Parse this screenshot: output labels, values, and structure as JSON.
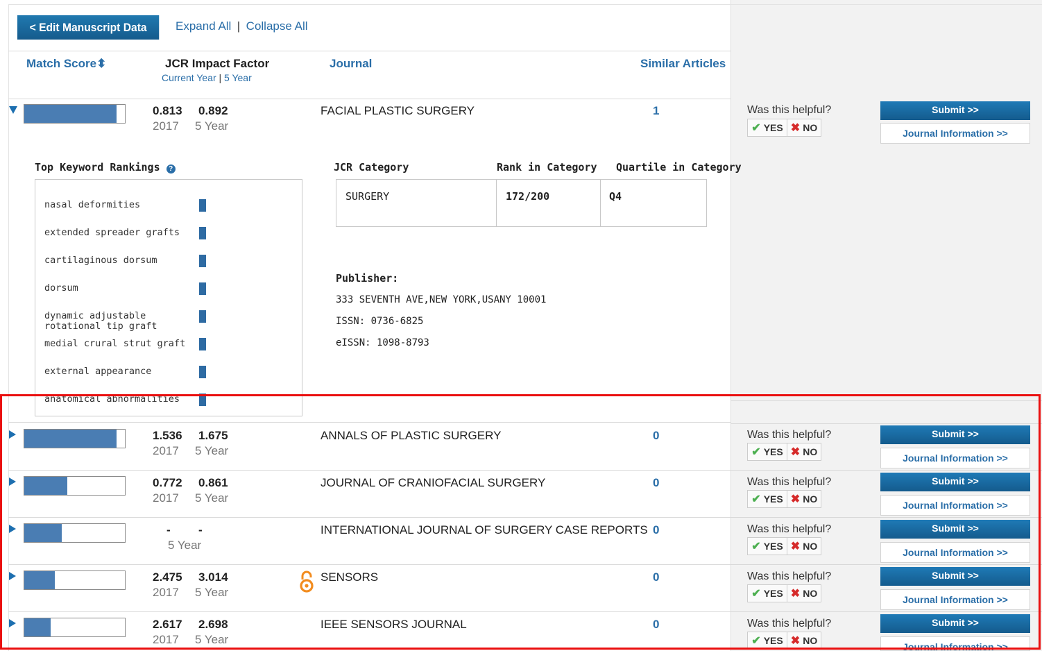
{
  "toolbar": {
    "edit_label": "< Edit Manuscript Data",
    "expand_label": "Expand All",
    "separator": "|",
    "collapse_label": "Collapse All"
  },
  "headers": {
    "match_score": "Match Score⬍",
    "jcr_title": "JCR Impact Factor",
    "jcr_current": "Current Year",
    "jcr_sep": "|",
    "jcr_5year": "5 Year",
    "journal": "Journal",
    "similar": "Similar Articles"
  },
  "labels": {
    "helpful": "Was this helpful?",
    "yes": "YES",
    "no": "NO",
    "submit": "Submit >>",
    "journal_info": "Journal Information >>",
    "five_year": "5 Year"
  },
  "expanded": {
    "keywords_title": "Top Keyword Rankings",
    "keywords": [
      "nasal deformities",
      "extended spreader grafts",
      "cartilaginous dorsum",
      "dorsum",
      "dynamic adjustable rotational tip graft",
      "medial crural strut graft",
      "external appearance",
      "anatomical abnormalities"
    ],
    "cat_header": "JCR Category",
    "rank_header": "Rank in Category",
    "quartile_header": "Quartile in Category",
    "category": "SURGERY",
    "rank": "172/200",
    "quartile": "Q4",
    "publisher_label": "Publisher:",
    "publisher_address": "333 SEVENTH AVE,NEW YORK,USANY 10001",
    "issn": "ISSN: 0736-6825",
    "eissn": "eISSN: 1098-8793"
  },
  "rows": [
    {
      "journal": "FACIAL PLASTIC SURGERY",
      "if_current": "0.813",
      "if_5year": "0.892",
      "year": "2017",
      "similar": "1",
      "match": 0.92,
      "expanded": true
    },
    {
      "journal": "ANNALS OF PLASTIC SURGERY",
      "if_current": "1.536",
      "if_5year": "1.675",
      "year": "2017",
      "similar": "0",
      "match": 0.92
    },
    {
      "journal": "JOURNAL OF CRANIOFACIAL SURGERY",
      "if_current": "0.772",
      "if_5year": "0.861",
      "year": "2017",
      "similar": "0",
      "match": 0.43
    },
    {
      "journal": "INTERNATIONAL JOURNAL OF SURGERY CASE REPORTS",
      "if_current": "-",
      "if_5year": "-",
      "year": "",
      "similar": "0",
      "match": 0.37
    },
    {
      "journal": "SENSORS",
      "if_current": "2.475",
      "if_5year": "3.014",
      "year": "2017",
      "similar": "0",
      "match": 0.3,
      "open_access": true
    },
    {
      "journal": "IEEE SENSORS JOURNAL",
      "if_current": "2.617",
      "if_5year": "2.698",
      "year": "2017",
      "similar": "0",
      "match": 0.26
    }
  ],
  "colors": {
    "accent": "#2a6ea8",
    "bar_fill": "#4a7db3",
    "highlight": "#ea0f0f",
    "open_access": "#f28c1f"
  },
  "icons": {
    "expand": "triangle-down-icon",
    "collapse": "triangle-right-icon",
    "help": "question-circle-icon",
    "yes": "checkmark-icon",
    "no": "x-icon",
    "oa": "open-access-lock-icon"
  }
}
